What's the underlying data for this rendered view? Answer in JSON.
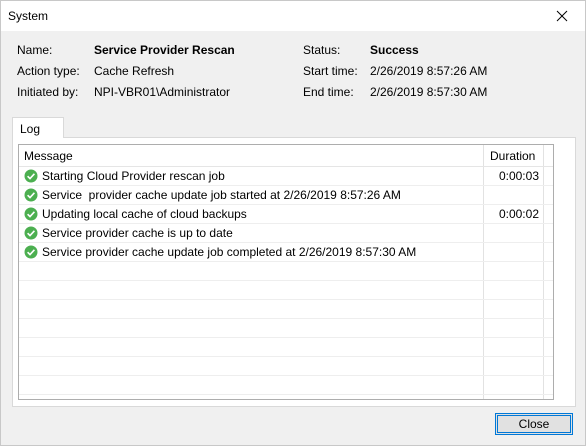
{
  "window": {
    "title": "System"
  },
  "info": {
    "name_label": "Name:",
    "name_value": "Service Provider Rescan",
    "action_type_label": "Action type:",
    "action_type_value": "Cache Refresh",
    "initiated_by_label": "Initiated by:",
    "initiated_by_value": "NPI-VBR01\\Administrator",
    "status_label": "Status:",
    "status_value": "Success",
    "start_time_label": "Start time:",
    "start_time_value": "2/26/2019 8:57:26 AM",
    "end_time_label": "End time:",
    "end_time_value": "2/26/2019 8:57:30 AM"
  },
  "tabs": [
    {
      "label": "Log"
    }
  ],
  "log": {
    "columns": {
      "message": "Message",
      "duration": "Duration"
    },
    "rows": [
      {
        "icon": "success-check-icon",
        "message": "Starting Cloud Provider rescan job",
        "duration": "0:00:03"
      },
      {
        "icon": "success-check-icon",
        "message": "Service  provider cache update job started at 2/26/2019 8:57:26 AM",
        "duration": ""
      },
      {
        "icon": "success-check-icon",
        "message": "Updating local cache of cloud backups",
        "duration": "0:00:02"
      },
      {
        "icon": "success-check-icon",
        "message": "Service provider cache is up to date",
        "duration": ""
      },
      {
        "icon": "success-check-icon",
        "message": "Service provider cache update job completed at 2/26/2019 8:57:30 AM",
        "duration": ""
      }
    ]
  },
  "buttons": {
    "close_label": "Close"
  },
  "colors": {
    "success": "#4caf50",
    "accent": "#0078d7"
  }
}
